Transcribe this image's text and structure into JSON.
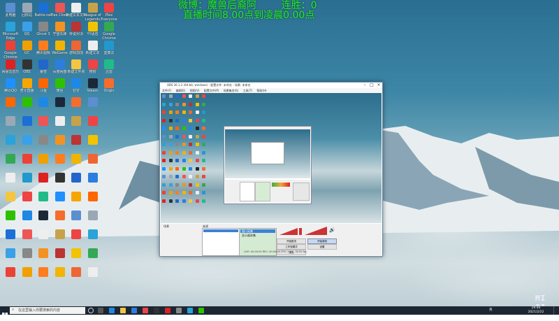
{
  "overlay": {
    "line1": "微博：魔兽后裔阿        连胜：0",
    "line2": "直播时间8.00点到凌晨0.00点"
  },
  "desktop_icons": [
    {
      "label": "此电脑",
      "color": "#5b8fd0"
    },
    {
      "label": "回收站",
      "color": "#9aa8b5"
    },
    {
      "label": "Battle.net",
      "color": "#1c6fd6"
    },
    {
      "label": "Plex Client",
      "color": "#e55"
    },
    {
      "label": "新建文本文档",
      "color": "#eee"
    },
    {
      "label": "League of Legends",
      "color": "#c8a24a"
    },
    {
      "label": "Plex Everyone",
      "color": "#e44"
    },
    {
      "label": "Microsoft Edge",
      "color": "#2aa3d8"
    },
    {
      "label": "QQ",
      "color": "#3aa0e8"
    },
    {
      "label": "Ghost 3",
      "color": "#888"
    },
    {
      "label": "守望先锋",
      "color": "#f39222"
    },
    {
      "label": "传说对决",
      "color": "#b33"
    },
    {
      "label": "YY语音",
      "color": "#f2c300"
    },
    {
      "label": "Google Chrome",
      "color": "#34a853"
    },
    {
      "label": "Google Chrome",
      "color": "#ea4335"
    },
    {
      "label": "UC",
      "color": "#f0a000"
    },
    {
      "label": "腾讯视频",
      "color": "#ff7d1e"
    },
    {
      "label": "WeGame",
      "color": "#f2b400"
    },
    {
      "label": "游戏加加",
      "color": "#e63"
    },
    {
      "label": "新建文本",
      "color": "#eee"
    },
    {
      "label": "蓝奏云",
      "color": "#29c"
    },
    {
      "label": "网易云音乐",
      "color": "#d22"
    },
    {
      "label": "OBS",
      "color": "#333"
    },
    {
      "label": "暴雪",
      "color": "#2266cc"
    },
    {
      "label": "百度网盘",
      "color": "#2b7de0"
    },
    {
      "label": "新建文件夹",
      "color": "#f5c542"
    },
    {
      "label": "搜狗",
      "color": "#e44"
    },
    {
      "label": "迅雷",
      "color": "#2b8"
    },
    {
      "label": "腾讯QQ",
      "color": "#1e90ff"
    },
    {
      "label": "虎牙直播",
      "color": "#f7a600"
    },
    {
      "label": "斗鱼",
      "color": "#f60"
    },
    {
      "label": "微信",
      "color": "#2dc100"
    },
    {
      "label": "钉钉",
      "color": "#1e88e5"
    },
    {
      "label": "Steam",
      "color": "#1b2838"
    },
    {
      "label": "Origin",
      "color": "#f56c2d"
    }
  ],
  "obs": {
    "title": "OBS 26.1.2 (64-bit, windows) - 配置文件: 未命名 - 场景: 未命名",
    "menu": [
      "文件(F)",
      "编辑(E)",
      "视图(V)",
      "配置文件(P)",
      "场景集合(S)",
      "工具(T)",
      "帮助(H)"
    ],
    "scenes_header": "场景",
    "sources_header": "来源",
    "sources": [
      "窗口采集",
      "显示器采集"
    ],
    "controls": [
      "开始推流",
      "开始录制",
      "工作室模式",
      "设置",
      "退出"
    ],
    "status": "LIVE: 00:00:00   REC: 00:00:00   CPU: 2.1%, 30.00 fps"
  },
  "taskbar": {
    "search_placeholder": "在这里输入你要搜索的内容",
    "time": "19:46",
    "date": "2021/2/22",
    "lang": "英"
  },
  "watermark": "MI II"
}
